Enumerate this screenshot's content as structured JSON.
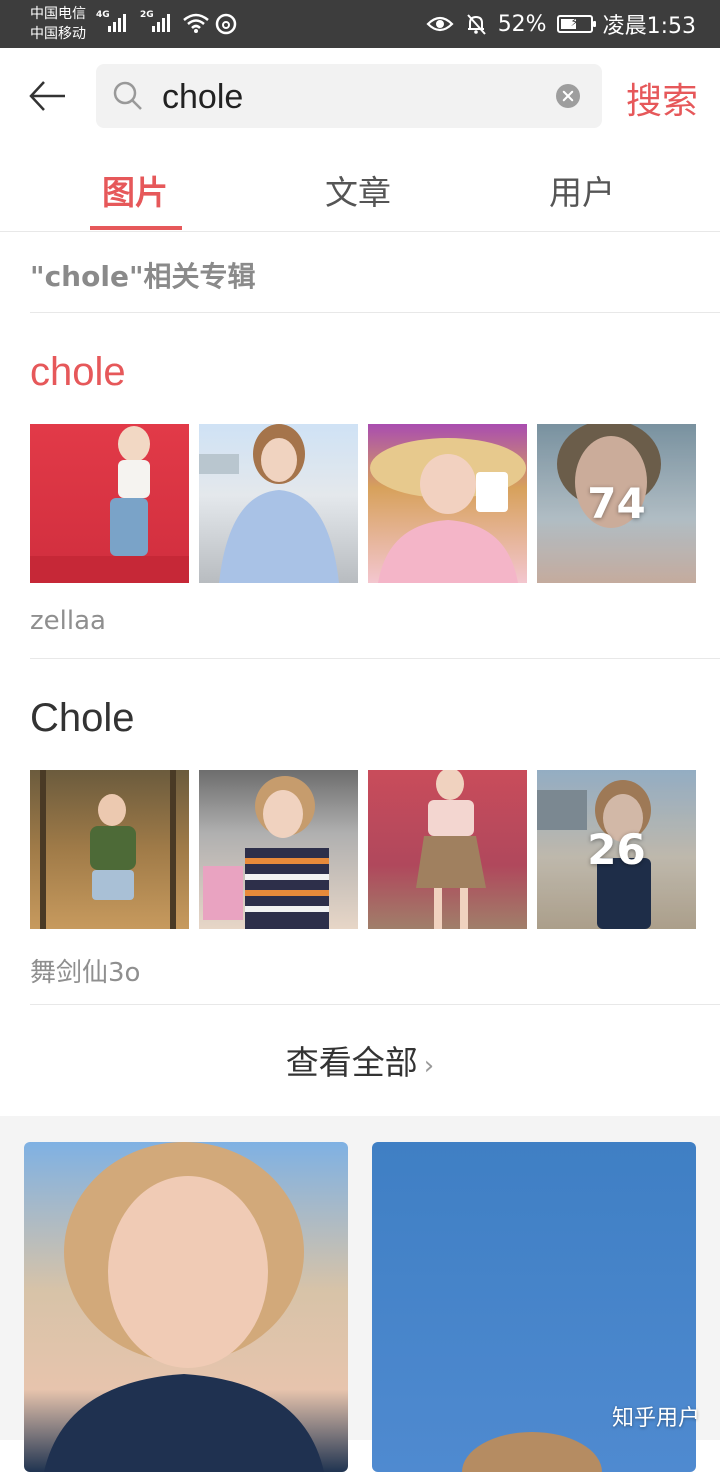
{
  "status_bar": {
    "carrier_1": "中国电信",
    "carrier_2": "中国移动",
    "net_1": "4G",
    "net_2": "2G",
    "battery_percent": "52%",
    "battery_level": 0.52,
    "time": "凌晨1:53"
  },
  "search": {
    "query": "chole",
    "submit_label": "搜索"
  },
  "tabs": [
    {
      "label": "图片",
      "active": true
    },
    {
      "label": "文章",
      "active": false
    },
    {
      "label": "用户",
      "active": false
    }
  ],
  "related_albums": {
    "section_title": "\"chole\"相关专辑",
    "albums": [
      {
        "name": "chole",
        "owner": "zellaa",
        "more_count": "74"
      },
      {
        "name": "Chole",
        "owner": "舞剑仙3o",
        "more_count": "26"
      }
    ],
    "view_all_label": "查看全部"
  },
  "watermark": "知乎用户",
  "colors": {
    "accent": "#e6585a",
    "status_bar": "#3d3d3d",
    "feed_background": "#f4f4f4"
  }
}
